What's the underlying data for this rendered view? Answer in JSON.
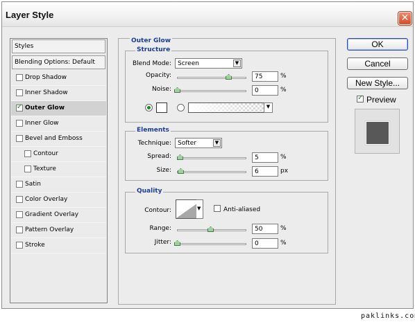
{
  "window": {
    "title": "Layer Style"
  },
  "styles_panel": {
    "header": "Styles",
    "blending_options": "Blending Options: Default",
    "items": [
      {
        "label": "Drop Shadow",
        "checked": false
      },
      {
        "label": "Inner Shadow",
        "checked": false
      },
      {
        "label": "Outer Glow",
        "checked": true,
        "selected": true
      },
      {
        "label": "Inner Glow",
        "checked": false
      },
      {
        "label": "Bevel and Emboss",
        "checked": false
      },
      {
        "label": "Contour",
        "checked": false,
        "indent": true
      },
      {
        "label": "Texture",
        "checked": false,
        "indent": true
      },
      {
        "label": "Satin",
        "checked": false
      },
      {
        "label": "Color Overlay",
        "checked": false
      },
      {
        "label": "Gradient Overlay",
        "checked": false
      },
      {
        "label": "Pattern Overlay",
        "checked": false
      },
      {
        "label": "Stroke",
        "checked": false
      }
    ]
  },
  "outer_glow": {
    "title": "Outer Glow",
    "structure": {
      "title": "Structure",
      "blend_mode_label": "Blend Mode:",
      "blend_mode_value": "Screen",
      "opacity_label": "Opacity:",
      "opacity_value": "75",
      "opacity_unit": "%",
      "noise_label": "Noise:",
      "noise_value": "0",
      "noise_unit": "%"
    },
    "elements": {
      "title": "Elements",
      "technique_label": "Technique:",
      "technique_value": "Softer",
      "spread_label": "Spread:",
      "spread_value": "5",
      "spread_unit": "%",
      "size_label": "Size:",
      "size_value": "6",
      "size_unit": "px"
    },
    "quality": {
      "title": "Quality",
      "contour_label": "Contour:",
      "anti_aliased_label": "Anti-aliased",
      "range_label": "Range:",
      "range_value": "50",
      "range_unit": "%",
      "jitter_label": "Jitter:",
      "jitter_value": "0",
      "jitter_unit": "%"
    }
  },
  "buttons": {
    "ok": "OK",
    "cancel": "Cancel",
    "new_style": "New Style...",
    "preview_label": "Preview"
  },
  "watermark": "paklinks.com",
  "colors": {
    "title_accent": "#1c3c9c",
    "close_button": "#d84a22",
    "preview_swatch": "#585858"
  }
}
